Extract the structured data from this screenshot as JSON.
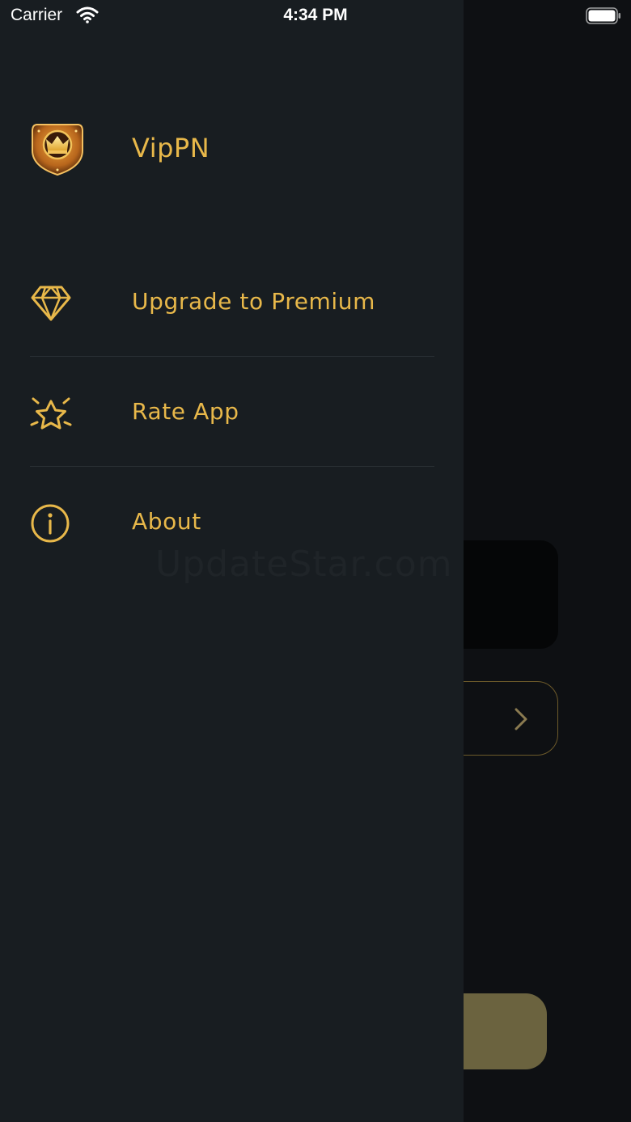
{
  "status_bar": {
    "carrier": "Carrier",
    "time": "4:34 PM"
  },
  "drawer": {
    "app_name": "VipPN",
    "menu": [
      {
        "label": "Upgrade to Premium",
        "icon": "diamond-icon"
      },
      {
        "label": "Rate App",
        "icon": "star-icon"
      },
      {
        "label": "About",
        "icon": "info-icon"
      }
    ]
  },
  "watermark": "UpdateStar.com",
  "colors": {
    "accent": "#e8b84a",
    "drawer_bg": "#181d21",
    "screen_bg": "#0e1013"
  }
}
